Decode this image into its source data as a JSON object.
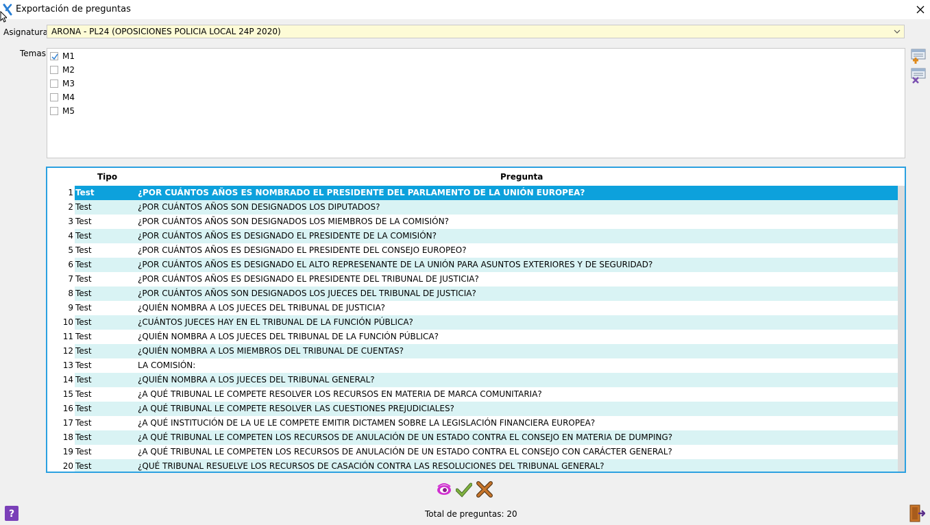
{
  "window": {
    "title": "Exportación de preguntas"
  },
  "asignatura": {
    "label": "Asignatura",
    "value": "ARONA - PL24 (OPOSICIONES POLICIA LOCAL 24P 2020)"
  },
  "temas": {
    "label": "Temas",
    "items": [
      {
        "label": "M1",
        "checked": true
      },
      {
        "label": "M2",
        "checked": false
      },
      {
        "label": "M3",
        "checked": false
      },
      {
        "label": "M4",
        "checked": false
      },
      {
        "label": "M5",
        "checked": false
      }
    ]
  },
  "table": {
    "headers": {
      "tipo": "Tipo",
      "pregunta": "Pregunta"
    },
    "rows": [
      {
        "n": "1",
        "tipo": "Test",
        "pregunta": "¿POR CUÁNTOS AÑOS ES NOMBRADO EL PRESIDENTE DEL PARLAMENTO DE LA UNIÓN EUROPEA?"
      },
      {
        "n": "2",
        "tipo": "Test",
        "pregunta": "¿POR CUÁNTOS AÑOS SON DESIGNADOS LOS DIPUTADOS?"
      },
      {
        "n": "3",
        "tipo": "Test",
        "pregunta": "¿POR CUÁNTOS AÑOS SON DESIGNADOS LOS MIEMBROS DE LA COMISIÓN?"
      },
      {
        "n": "4",
        "tipo": "Test",
        "pregunta": "¿POR CUÁNTOS AÑOS ES DESIGNADO EL PRESIDENTE DE LA COMISIÓN?"
      },
      {
        "n": "5",
        "tipo": "Test",
        "pregunta": "¿POR CUÁNTOS AÑOS ES DESIGNADO EL PRESIDENTE DEL CONSEJO EUROPEO?"
      },
      {
        "n": "6",
        "tipo": "Test",
        "pregunta": "¿POR CUÁNTOS AÑOS ES DESIGNADO EL ALTO REPRESENANTE DE LA UNIÓN PARA ASUNTOS EXTERIORES Y DE SEGURIDAD?"
      },
      {
        "n": "7",
        "tipo": "Test",
        "pregunta": "¿POR CUÁNTOS AÑOS ES DESIGNADO EL PRESIDENTE DEL TRIBUNAL DE JUSTICIA?"
      },
      {
        "n": "8",
        "tipo": "Test",
        "pregunta": "¿POR CUÁNTOS AÑOS SON DESIGNADOS LOS JUECES DEL TRIBUNAL DE JUSTICIA?"
      },
      {
        "n": "9",
        "tipo": "Test",
        "pregunta": "¿QUIÉN NOMBRA A LOS JUECES DEL TRIBUNAL DE JUSTICIA?"
      },
      {
        "n": "10",
        "tipo": "Test",
        "pregunta": "¿CUÁNTOS JUECES HAY EN EL TRIBUNAL DE LA FUNCIÓN PÚBLICA?"
      },
      {
        "n": "11",
        "tipo": "Test",
        "pregunta": "¿QUIÉN NOMBRA A LOS JUECES DEL TRIBUNAL DE LA FUNCIÓN PÚBLICA?"
      },
      {
        "n": "12",
        "tipo": "Test",
        "pregunta": "¿QUIÉN NOMBRA A LOS MIEMBROS DEL TRIBUNAL DE CUENTAS?"
      },
      {
        "n": "13",
        "tipo": "Test",
        "pregunta": "LA COMISIÓN:"
      },
      {
        "n": "14",
        "tipo": "Test",
        "pregunta": "¿QUIÉN NOMBRA A LOS JUECES DEL TRIBUNAL GENERAL?"
      },
      {
        "n": "15",
        "tipo": "Test",
        "pregunta": "¿A QUÉ TRIBUNAL LE COMPETE RESOLVER LOS RECURSOS EN MATERIA DE MARCA COMUNITARIA?"
      },
      {
        "n": "16",
        "tipo": "Test",
        "pregunta": "¿A QUÉ TRIBUNAL LE COMPETE RESOLVER LAS CUESTIONES PREJUDICIALES?"
      },
      {
        "n": "17",
        "tipo": "Test",
        "pregunta": "¿A QUÉ INSTITUCIÓN DE LA UE LE COMPETE EMITIR DICTAMEN SOBRE LA LEGISLACIÓN FINANCIERA EUROPEA?"
      },
      {
        "n": "18",
        "tipo": "Test",
        "pregunta": "¿A QUÉ TRIBUNAL LE COMPETEN LOS RECURSOS DE ANULACIÓN DE UN ESTADO CONTRA EL CONSEJO EN MATERIA DE DUMPING?"
      },
      {
        "n": "19",
        "tipo": "Test",
        "pregunta": "¿A QUÉ TRIBUNAL LE COMPETEN LOS RECURSOS DE ANULACIÓN DE UN ESTADO CONTRA EL CONSEJO CON CARÁCTER GENERAL?"
      },
      {
        "n": "20",
        "tipo": "Test",
        "pregunta": "¿QUÉ TRIBUNAL RESUELVE LOS RECURSOS DE CASACIÓN CONTRA LAS RESOLUCIONES DEL TRIBUNAL GENERAL?"
      }
    ],
    "selected_row": "1"
  },
  "footer": {
    "total": "Total de preguntas: 20"
  },
  "icons": {
    "app": "app-x-icon",
    "combo_arrow": "chevron-down-icon",
    "select_all": "select-all-icon",
    "deselect_all": "deselect-all-icon",
    "preview": "eye-icon",
    "accept": "check-icon",
    "cancel": "cross-icon",
    "help": "help-icon",
    "exit": "exit-door-icon"
  },
  "colors": {
    "selection": "#0da1dc",
    "row_alt": "#d9f3f4",
    "grid_border": "#2aa0e0",
    "combo_bg": "#fdfbd6"
  }
}
